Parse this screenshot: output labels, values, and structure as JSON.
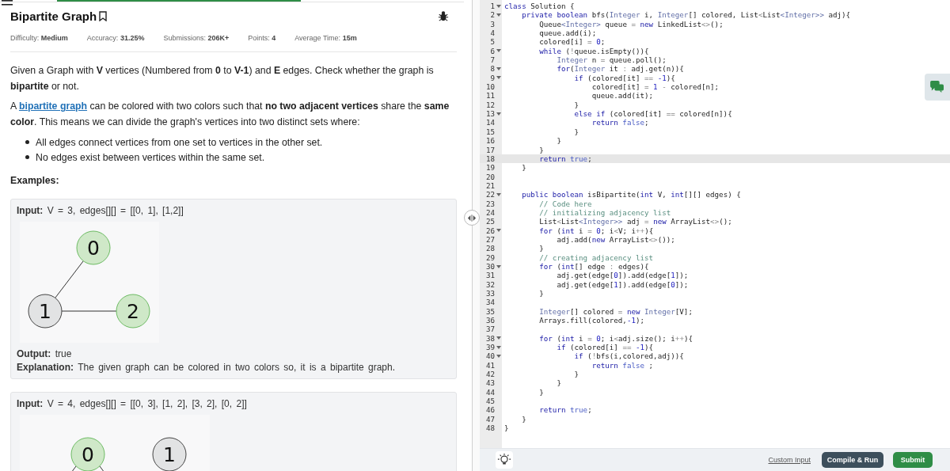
{
  "problem": {
    "title": "Bipartite Graph",
    "bookmarked": false,
    "meta": [
      {
        "label": "Difficulty:",
        "value": "Medium"
      },
      {
        "label": "Accuracy:",
        "value": "31.25%"
      },
      {
        "label": "Submissions:",
        "value": "206K+"
      },
      {
        "label": "Points:",
        "value": "4"
      },
      {
        "label": "Average Time:",
        "value": "15m"
      }
    ],
    "paragraphs": [
      {
        "kind": "text",
        "text": "Given a Graph with **V** vertices (Numbered from **0** to **V-1**) and **E** edges. Check whether the graph is **bipartite** or not."
      },
      {
        "kind": "link",
        "before": "A ",
        "link": "bipartite graph",
        "after": " can be colored with two colors such that **no two adjacent vertices** share the **same color**. This means we can divide the graph's vertices into two distinct sets where:"
      }
    ],
    "bullets": [
      "All edges connect vertices from one set to vertices in the other set.",
      "No edges exist between vertices within the same set."
    ],
    "examples_heading": "Examples:",
    "examples": [
      {
        "input_label": "Input:",
        "input": "V = 3, edges[][] = [[0, 1], [1,2]]",
        "nodes": [
          {
            "label": "0",
            "color": "#cfe8c8"
          },
          {
            "label": "1",
            "color": "#e2e3e4"
          },
          {
            "label": "2",
            "color": "#cfe8c8"
          }
        ],
        "output_label": "Output:",
        "output": "true",
        "explanation_label": "Explanation:",
        "explanation": "The given graph can be colored in two colors so, it is a bipartite graph."
      },
      {
        "input_label": "Input:",
        "input": "V = 4, edges[][] = [[0, 3], [1, 2], [3, 2], [0, 2]]",
        "nodes": [
          {
            "label": "0",
            "color": "#cfe8c8"
          },
          {
            "label": "1",
            "color": "#e2e3e4"
          }
        ]
      }
    ]
  },
  "editor": {
    "lines": [
      {
        "n": "1",
        "fold": true,
        "current": false,
        "segs": [
          {
            "text": "class",
            "kind": "k"
          },
          {
            "text": " Solution {",
            "kind": "p"
          }
        ]
      },
      {
        "n": "2",
        "fold": true,
        "current": false,
        "segs": [
          {
            "text": "    private boolean",
            "kind": "k"
          },
          {
            "text": " bfs(",
            "kind": "p"
          },
          {
            "text": "Integer",
            "kind": "t"
          },
          {
            "text": " i, ",
            "kind": "p"
          },
          {
            "text": "Integer",
            "kind": "t"
          },
          {
            "text": "[] colored, List",
            "kind": "p"
          },
          {
            "text": "<",
            "kind": "o"
          },
          {
            "text": "List",
            "kind": "p"
          },
          {
            "text": "<Integer>>",
            "kind": "t"
          },
          {
            "text": " adj){",
            "kind": "p"
          }
        ]
      },
      {
        "n": "3",
        "fold": false,
        "current": false,
        "segs": [
          {
            "text": "        Queue",
            "kind": "p"
          },
          {
            "text": "<Integer>",
            "kind": "t"
          },
          {
            "text": " queue ",
            "kind": "p"
          },
          {
            "text": "= ",
            "kind": "o"
          },
          {
            "text": "new",
            "kind": "k"
          },
          {
            "text": " LinkedList",
            "kind": "p"
          },
          {
            "text": "<>",
            "kind": "o"
          },
          {
            "text": "();",
            "kind": "p"
          }
        ]
      },
      {
        "n": "4",
        "fold": false,
        "current": false,
        "segs": [
          {
            "text": "        queue.add(i);",
            "kind": "p"
          }
        ]
      },
      {
        "n": "5",
        "fold": false,
        "current": false,
        "segs": [
          {
            "text": "        colored[i] ",
            "kind": "p"
          },
          {
            "text": "= ",
            "kind": "o"
          },
          {
            "text": "0",
            "kind": "n"
          },
          {
            "text": ";",
            "kind": "p"
          }
        ]
      },
      {
        "n": "6",
        "fold": true,
        "current": false,
        "segs": [
          {
            "text": "        while",
            "kind": "k"
          },
          {
            "text": " (",
            "kind": "p"
          },
          {
            "text": "!",
            "kind": "o"
          },
          {
            "text": "queue.isEmpty()){",
            "kind": "p"
          }
        ]
      },
      {
        "n": "7",
        "fold": false,
        "current": false,
        "segs": [
          {
            "text": "            Integer",
            "kind": "t"
          },
          {
            "text": " n ",
            "kind": "p"
          },
          {
            "text": "=",
            "kind": "o"
          },
          {
            "text": " queue.poll();",
            "kind": "p"
          }
        ]
      },
      {
        "n": "8",
        "fold": true,
        "current": false,
        "segs": [
          {
            "text": "            for",
            "kind": "k"
          },
          {
            "text": "(",
            "kind": "p"
          },
          {
            "text": "Integer",
            "kind": "t"
          },
          {
            "text": " it ",
            "kind": "p"
          },
          {
            "text": ":",
            "kind": "o"
          },
          {
            "text": " adj.get(n)){",
            "kind": "p"
          }
        ]
      },
      {
        "n": "9",
        "fold": true,
        "current": false,
        "segs": [
          {
            "text": "                if",
            "kind": "k"
          },
          {
            "text": " (colored[it] ",
            "kind": "p"
          },
          {
            "text": "== ",
            "kind": "o"
          },
          {
            "text": "-1",
            "kind": "n"
          },
          {
            "text": "){",
            "kind": "p"
          }
        ]
      },
      {
        "n": "10",
        "fold": false,
        "current": false,
        "segs": [
          {
            "text": "                    colored[it] ",
            "kind": "p"
          },
          {
            "text": "= ",
            "kind": "o"
          },
          {
            "text": "1",
            "kind": "n"
          },
          {
            "text": " - ",
            "kind": "o"
          },
          {
            "text": "colored[n];",
            "kind": "p"
          }
        ]
      },
      {
        "n": "11",
        "fold": false,
        "current": false,
        "segs": [
          {
            "text": "                    queue.add(it);",
            "kind": "p"
          }
        ]
      },
      {
        "n": "12",
        "fold": false,
        "current": false,
        "segs": [
          {
            "text": "                }",
            "kind": "p"
          }
        ]
      },
      {
        "n": "13",
        "fold": true,
        "current": false,
        "segs": [
          {
            "text": "                else if",
            "kind": "k"
          },
          {
            "text": " (colored[it] ",
            "kind": "p"
          },
          {
            "text": "==",
            "kind": "o"
          },
          {
            "text": " colored[n]){",
            "kind": "p"
          }
        ]
      },
      {
        "n": "14",
        "fold": false,
        "current": false,
        "segs": [
          {
            "text": "                    return",
            "kind": "k"
          },
          {
            "text": " false",
            "kind": "v"
          },
          {
            "text": ";",
            "kind": "p"
          }
        ]
      },
      {
        "n": "15",
        "fold": false,
        "current": false,
        "segs": [
          {
            "text": "                }",
            "kind": "p"
          }
        ]
      },
      {
        "n": "16",
        "fold": false,
        "current": false,
        "segs": [
          {
            "text": "            }",
            "kind": "p"
          }
        ]
      },
      {
        "n": "17",
        "fold": false,
        "current": false,
        "segs": [
          {
            "text": "        }",
            "kind": "p"
          }
        ]
      },
      {
        "n": "18",
        "fold": false,
        "current": true,
        "segs": [
          {
            "text": "        return",
            "kind": "k"
          },
          {
            "text": " true",
            "kind": "v"
          },
          {
            "text": ";",
            "kind": "p"
          }
        ]
      },
      {
        "n": "19",
        "fold": false,
        "current": false,
        "segs": [
          {
            "text": "    }",
            "kind": "p"
          }
        ]
      },
      {
        "n": "20",
        "fold": false,
        "current": false
      },
      {
        "n": "21",
        "fold": false,
        "current": false
      },
      {
        "n": "22",
        "fold": true,
        "current": false,
        "segs": [
          {
            "text": "    public boolean",
            "kind": "k"
          },
          {
            "text": " isBipartite(",
            "kind": "p"
          },
          {
            "text": "int",
            "kind": "k"
          },
          {
            "text": " V, ",
            "kind": "p"
          },
          {
            "text": "int",
            "kind": "k"
          },
          {
            "text": "[][] edges) {",
            "kind": "p"
          }
        ]
      },
      {
        "n": "23",
        "fold": false,
        "current": false,
        "segs": [
          {
            "text": "        // Code here",
            "kind": "c"
          }
        ]
      },
      {
        "n": "24",
        "fold": false,
        "current": false,
        "segs": [
          {
            "text": "        // initializing adjacency list",
            "kind": "c"
          }
        ]
      },
      {
        "n": "25",
        "fold": false,
        "current": false,
        "segs": [
          {
            "text": "        List",
            "kind": "p"
          },
          {
            "text": "<",
            "kind": "o"
          },
          {
            "text": "List",
            "kind": "p"
          },
          {
            "text": "<Integer>>",
            "kind": "t"
          },
          {
            "text": " adj ",
            "kind": "p"
          },
          {
            "text": "= ",
            "kind": "o"
          },
          {
            "text": "new",
            "kind": "k"
          },
          {
            "text": " ArrayList",
            "kind": "p"
          },
          {
            "text": "<>",
            "kind": "o"
          },
          {
            "text": "();",
            "kind": "p"
          }
        ]
      },
      {
        "n": "26",
        "fold": true,
        "current": false,
        "segs": [
          {
            "text": "        for",
            "kind": "k"
          },
          {
            "text": " (",
            "kind": "p"
          },
          {
            "text": "int",
            "kind": "k"
          },
          {
            "text": " i ",
            "kind": "p"
          },
          {
            "text": "= ",
            "kind": "o"
          },
          {
            "text": "0",
            "kind": "n"
          },
          {
            "text": "; i",
            "kind": "p"
          },
          {
            "text": "<",
            "kind": "o"
          },
          {
            "text": "V; i",
            "kind": "p"
          },
          {
            "text": "++",
            "kind": "o"
          },
          {
            "text": "){",
            "kind": "p"
          }
        ]
      },
      {
        "n": "27",
        "fold": false,
        "current": false,
        "segs": [
          {
            "text": "            adj.add(",
            "kind": "p"
          },
          {
            "text": "new",
            "kind": "k"
          },
          {
            "text": " ArrayList",
            "kind": "p"
          },
          {
            "text": "<>",
            "kind": "o"
          },
          {
            "text": "());",
            "kind": "p"
          }
        ]
      },
      {
        "n": "28",
        "fold": false,
        "current": false,
        "segs": [
          {
            "text": "        }",
            "kind": "p"
          }
        ]
      },
      {
        "n": "29",
        "fold": false,
        "current": false,
        "segs": [
          {
            "text": "        // creating adjacency list",
            "kind": "c"
          }
        ]
      },
      {
        "n": "30",
        "fold": true,
        "current": false,
        "segs": [
          {
            "text": "        for",
            "kind": "k"
          },
          {
            "text": " (",
            "kind": "p"
          },
          {
            "text": "int",
            "kind": "k"
          },
          {
            "text": "[] edge ",
            "kind": "p"
          },
          {
            "text": ":",
            "kind": "o"
          },
          {
            "text": " edges){",
            "kind": "p"
          }
        ]
      },
      {
        "n": "31",
        "fold": false,
        "current": false,
        "segs": [
          {
            "text": "            adj.get(edge[",
            "kind": "p"
          },
          {
            "text": "0",
            "kind": "n"
          },
          {
            "text": "]).add(edge[",
            "kind": "p"
          },
          {
            "text": "1",
            "kind": "n"
          },
          {
            "text": "]);",
            "kind": "p"
          }
        ]
      },
      {
        "n": "32",
        "fold": false,
        "current": false,
        "segs": [
          {
            "text": "            adj.get(edge[",
            "kind": "p"
          },
          {
            "text": "1",
            "kind": "n"
          },
          {
            "text": "]).add(edge[",
            "kind": "p"
          },
          {
            "text": "0",
            "kind": "n"
          },
          {
            "text": "]);",
            "kind": "p"
          }
        ]
      },
      {
        "n": "33",
        "fold": false,
        "current": false,
        "segs": [
          {
            "text": "        }",
            "kind": "p"
          }
        ]
      },
      {
        "n": "34",
        "fold": false,
        "current": false
      },
      {
        "n": "35",
        "fold": false,
        "current": false,
        "segs": [
          {
            "text": "        Integer",
            "kind": "t"
          },
          {
            "text": "[] colored ",
            "kind": "p"
          },
          {
            "text": "= ",
            "kind": "o"
          },
          {
            "text": "new",
            "kind": "k"
          },
          {
            "text": " Integer",
            "kind": "t"
          },
          {
            "text": "[V];",
            "kind": "p"
          }
        ]
      },
      {
        "n": "36",
        "fold": false,
        "current": false,
        "segs": [
          {
            "text": "        Arrays.fill(colored,",
            "kind": "p"
          },
          {
            "text": "-1",
            "kind": "n"
          },
          {
            "text": ");",
            "kind": "p"
          }
        ]
      },
      {
        "n": "37",
        "fold": false,
        "current": false
      },
      {
        "n": "38",
        "fold": true,
        "current": false,
        "segs": [
          {
            "text": "        for",
            "kind": "k"
          },
          {
            "text": " (",
            "kind": "p"
          },
          {
            "text": "int",
            "kind": "k"
          },
          {
            "text": " i ",
            "kind": "p"
          },
          {
            "text": "= ",
            "kind": "o"
          },
          {
            "text": "0",
            "kind": "n"
          },
          {
            "text": "; i",
            "kind": "p"
          },
          {
            "text": "<",
            "kind": "o"
          },
          {
            "text": "adj.size(); i",
            "kind": "p"
          },
          {
            "text": "++",
            "kind": "o"
          },
          {
            "text": "){",
            "kind": "p"
          }
        ]
      },
      {
        "n": "39",
        "fold": true,
        "current": false,
        "segs": [
          {
            "text": "            if",
            "kind": "k"
          },
          {
            "text": " (colored[i] ",
            "kind": "p"
          },
          {
            "text": "== ",
            "kind": "o"
          },
          {
            "text": "-1",
            "kind": "n"
          },
          {
            "text": "){",
            "kind": "p"
          }
        ]
      },
      {
        "n": "40",
        "fold": true,
        "current": false,
        "segs": [
          {
            "text": "                if",
            "kind": "k"
          },
          {
            "text": " (",
            "kind": "p"
          },
          {
            "text": "!",
            "kind": "o"
          },
          {
            "text": "bfs(i,colored,adj)){",
            "kind": "p"
          }
        ]
      },
      {
        "n": "41",
        "fold": false,
        "current": false,
        "segs": [
          {
            "text": "                    return",
            "kind": "k"
          },
          {
            "text": " false",
            "kind": "v"
          },
          {
            "text": " ;",
            "kind": "p"
          }
        ]
      },
      {
        "n": "42",
        "fold": false,
        "current": false,
        "segs": [
          {
            "text": "                }",
            "kind": "p"
          }
        ]
      },
      {
        "n": "43",
        "fold": false,
        "current": false,
        "segs": [
          {
            "text": "            }",
            "kind": "p"
          }
        ]
      },
      {
        "n": "44",
        "fold": false,
        "current": false,
        "segs": [
          {
            "text": "        }",
            "kind": "p"
          }
        ]
      },
      {
        "n": "45",
        "fold": false,
        "current": false
      },
      {
        "n": "46",
        "fold": false,
        "current": false,
        "segs": [
          {
            "text": "        return",
            "kind": "k"
          },
          {
            "text": " true",
            "kind": "v"
          },
          {
            "text": ";",
            "kind": "p"
          }
        ]
      },
      {
        "n": "47",
        "fold": false,
        "current": false,
        "segs": [
          {
            "text": "    }",
            "kind": "p"
          }
        ]
      },
      {
        "n": "48",
        "fold": false,
        "current": false,
        "segs": [
          {
            "text": "}",
            "kind": "p"
          }
        ]
      }
    ]
  },
  "footer": {
    "custom_input": "Custom Input",
    "compile": "Compile & Run",
    "submit": "Submit"
  }
}
